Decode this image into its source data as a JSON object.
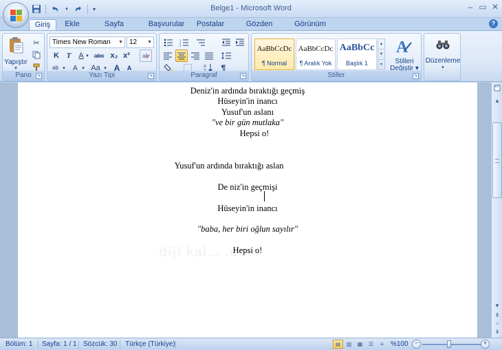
{
  "window": {
    "title": "Belge1 - Microsoft Word",
    "controls": [
      "–",
      "▭",
      "✕"
    ]
  },
  "quick_access": [
    "save-icon",
    "undo-icon",
    "redo-icon",
    "customize-icon"
  ],
  "tabs": [
    {
      "label": "Giriş",
      "active": true
    },
    {
      "label": "Ekle"
    },
    {
      "label": "Sayfa Düzeni"
    },
    {
      "label": "Başvurular"
    },
    {
      "label": "Postalar"
    },
    {
      "label": "Gözden Geçir"
    },
    {
      "label": "Görünüm"
    }
  ],
  "ribbon": {
    "clipboard": {
      "label": "Pano",
      "paste_label": "Yapıştır"
    },
    "font": {
      "label": "Yazı Tipi",
      "font_name": "Times New Roman",
      "font_size": "12",
      "bold": "K",
      "italic": "T",
      "underline": "A",
      "strike": "abc",
      "subscript": "x₂",
      "superscript": "x²",
      "case": "Aa",
      "grow": "A",
      "shrink": "A"
    },
    "paragraph": {
      "label": "Paragraf"
    },
    "styles": {
      "label": "Stiller",
      "items": [
        {
          "sample": "AaBbCcDc",
          "name": "¶ Normal",
          "selected": true
        },
        {
          "sample": "AaBbCcDc",
          "name": "¶ Aralık Yok"
        },
        {
          "sample": "AaBbCc",
          "name": "Başlık 1"
        }
      ],
      "change_styles": "Stilleri",
      "change_styles2": "Değiştir"
    },
    "editing": {
      "label": "Düzenleme"
    }
  },
  "document": {
    "lines": [
      {
        "text": "Deniz'in ardında bıraktığı geçmiş",
        "italic": false
      },
      {
        "text": "Hüseyin'in inancı",
        "italic": false
      },
      {
        "text": "Yusuf'un aslanı",
        "italic": false
      },
      {
        "text": "\"ve bir gün mutlaka\"",
        "italic": true
      },
      {
        "text": "Hepsi o!",
        "italic": false
      },
      {
        "text": "Yusuf'un ardında bıraktığı aslan",
        "italic": false
      },
      {
        "text": "De niz'in geçmişi",
        "italic": false
      },
      {
        "text": "Hüseyin'in inancı",
        "italic": false
      },
      {
        "text": "\"baba, her biri oğlun sayılır\"",
        "italic": true
      },
      {
        "text": "Hepsi o!",
        "italic": false
      }
    ],
    "watermark": "diji kal... .com"
  },
  "statusbar": {
    "section": "Bölüm: 1",
    "page": "Sayfa: 1 / 1",
    "words": "Sözcük: 30",
    "language": "Türkçe (Türkiye)",
    "zoom": "%100",
    "zoom_percent": 100
  }
}
